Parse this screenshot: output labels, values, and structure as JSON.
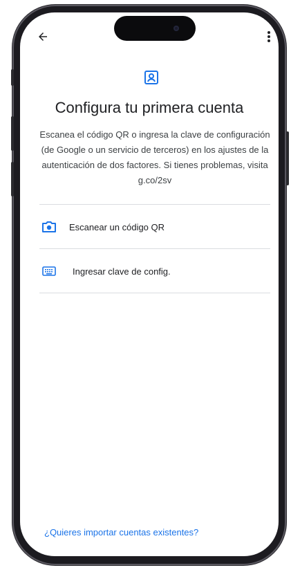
{
  "header": {
    "back_icon": "arrow-back-icon",
    "menu_icon": "more-vert-icon"
  },
  "hero": {
    "icon": "account-box-icon",
    "title": "Configura tu primera cuenta",
    "description": "Escanea el código QR o ingresa la clave de configuración (de Google o un servicio de terceros) en los ajustes de la autenticación de dos factores. Si tienes problemas, visita g.co/2sv"
  },
  "options": [
    {
      "icon": "camera-icon",
      "label": "Escanear un código QR"
    },
    {
      "icon": "keyboard-icon",
      "label": "Ingresar clave de config."
    }
  ],
  "footer": {
    "import_link": "¿Quieres importar cuentas existentes?"
  },
  "colors": {
    "accent": "#1a73e8",
    "text_primary": "#202124",
    "text_secondary": "#3c4043",
    "divider": "#dadce0",
    "frame": "#1c1b20"
  }
}
